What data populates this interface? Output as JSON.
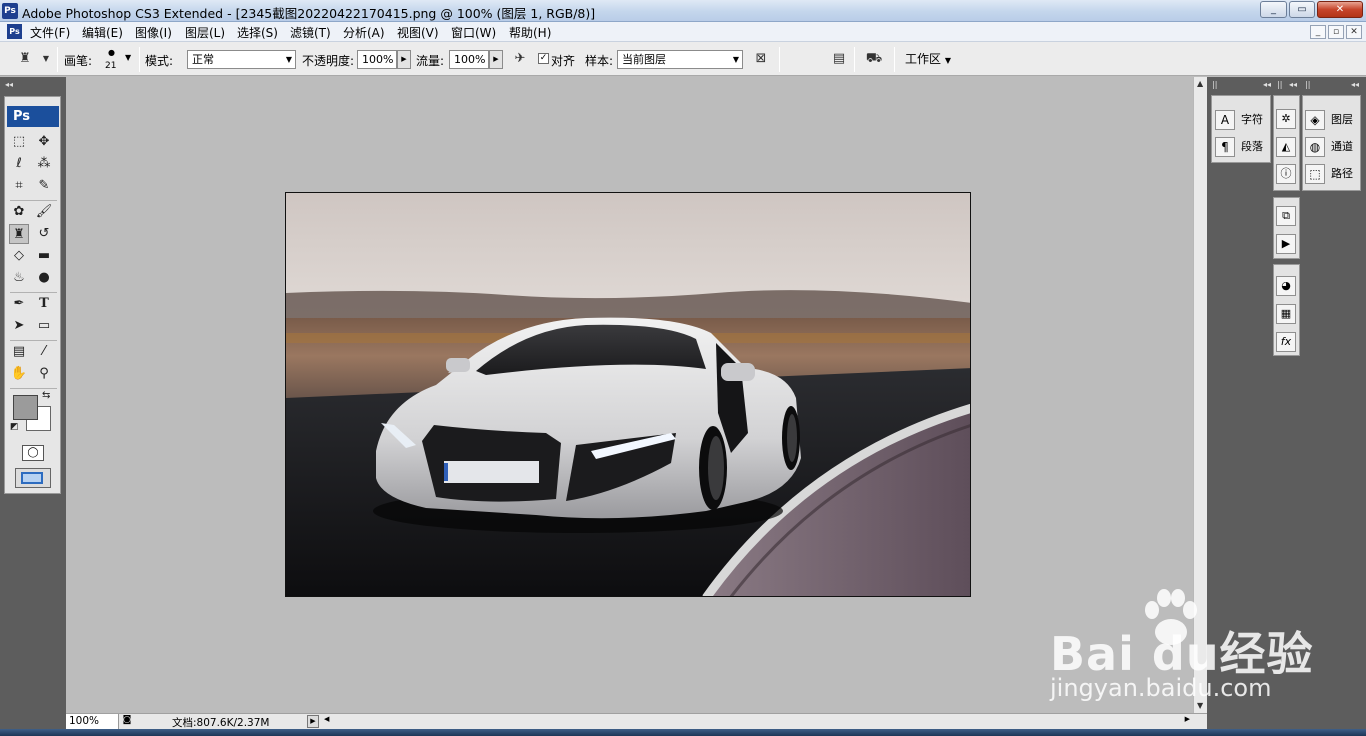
{
  "window": {
    "title": "Adobe Photoshop CS3 Extended - [2345截图20220422170415.png @ 100% (图层 1, RGB/8)]",
    "app_icon_label": "Ps",
    "controls": {
      "minimize": "_",
      "restore": "▭",
      "close": "✕"
    }
  },
  "menubar": {
    "items": [
      "文件(F)",
      "编辑(E)",
      "图像(I)",
      "图层(L)",
      "选择(S)",
      "滤镜(T)",
      "分析(A)",
      "视图(V)",
      "窗口(W)",
      "帮助(H)"
    ]
  },
  "options": {
    "brush_label": "画笔:",
    "brush_size": "21",
    "mode_label": "模式:",
    "mode_value": "正常",
    "opacity_label": "不透明度:",
    "opacity_value": "100%",
    "flow_label": "流量:",
    "flow_value": "100%",
    "align_label": "对齐",
    "align_checked": "✓",
    "sample_label": "样本:",
    "sample_value": "当前图层",
    "workspace_label": "工作区"
  },
  "toolbox": {
    "badge": "Ps",
    "icons": [
      "marquee-icon",
      "move-icon",
      "lasso-icon",
      "magic-wand-icon",
      "crop-icon",
      "slice-icon",
      "healing-brush-icon",
      "brush-icon",
      "clone-stamp-icon",
      "history-brush-icon",
      "eraser-icon",
      "gradient-icon",
      "blur-icon",
      "dodge-icon",
      "pen-icon",
      "type-icon",
      "path-selection-icon",
      "shape-icon",
      "notes-icon",
      "eyedropper-icon",
      "hand-icon",
      "zoom-icon"
    ],
    "selected_tool": "clone-stamp-icon",
    "foreground_color": "#9b9b9b",
    "background_color": "#ffffff"
  },
  "status": {
    "zoom": "100%",
    "doc_info": "文档:807.6K/2.37M"
  },
  "panels": {
    "character": "字符",
    "paragraph": "段落",
    "layers": "图层",
    "channels": "通道",
    "paths": "路径"
  },
  "watermark": {
    "main": "Bai du经验",
    "sub": "jingyan.baidu.com"
  }
}
